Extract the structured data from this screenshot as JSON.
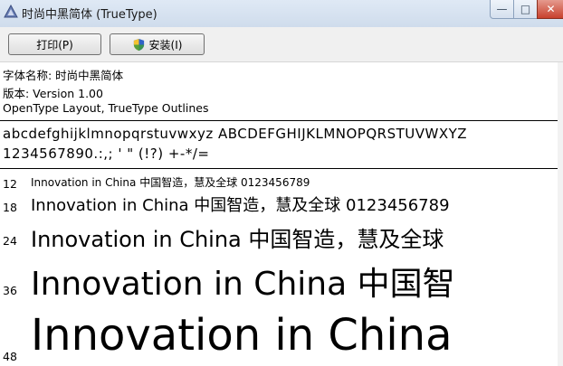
{
  "window": {
    "title": "时尚中黑简体 (TrueType)",
    "minimize_label": "—",
    "maximize_label": "□",
    "close_label": "✕"
  },
  "toolbar": {
    "print_label": "打印(P)",
    "install_label": "安装(I)"
  },
  "info": {
    "font_name_line": "字体名称: 时尚中黑简体",
    "version_line": "版本: Version  1.00",
    "type_line": "OpenType Layout, TrueType Outlines"
  },
  "charset": {
    "line1": "abcdefghijklmnopqrstuvwxyz ABCDEFGHIJKLMNOPQRSTUVWXYZ",
    "line2": "1234567890.:,; ' \" (!?) +-*/="
  },
  "samples": [
    {
      "size": "12",
      "text": "Innovation in China 中国智造，慧及全球 0123456789"
    },
    {
      "size": "18",
      "text": "Innovation in China 中国智造，慧及全球 0123456789"
    },
    {
      "size": "24",
      "text": "Innovation in China 中国智造，慧及全球"
    },
    {
      "size": "36",
      "text": "Innovation in China 中国智"
    },
    {
      "size": "48",
      "text": "Innovation in China"
    }
  ],
  "icons": {
    "app": "font-file-icon",
    "install": "uac-shield-icon"
  }
}
